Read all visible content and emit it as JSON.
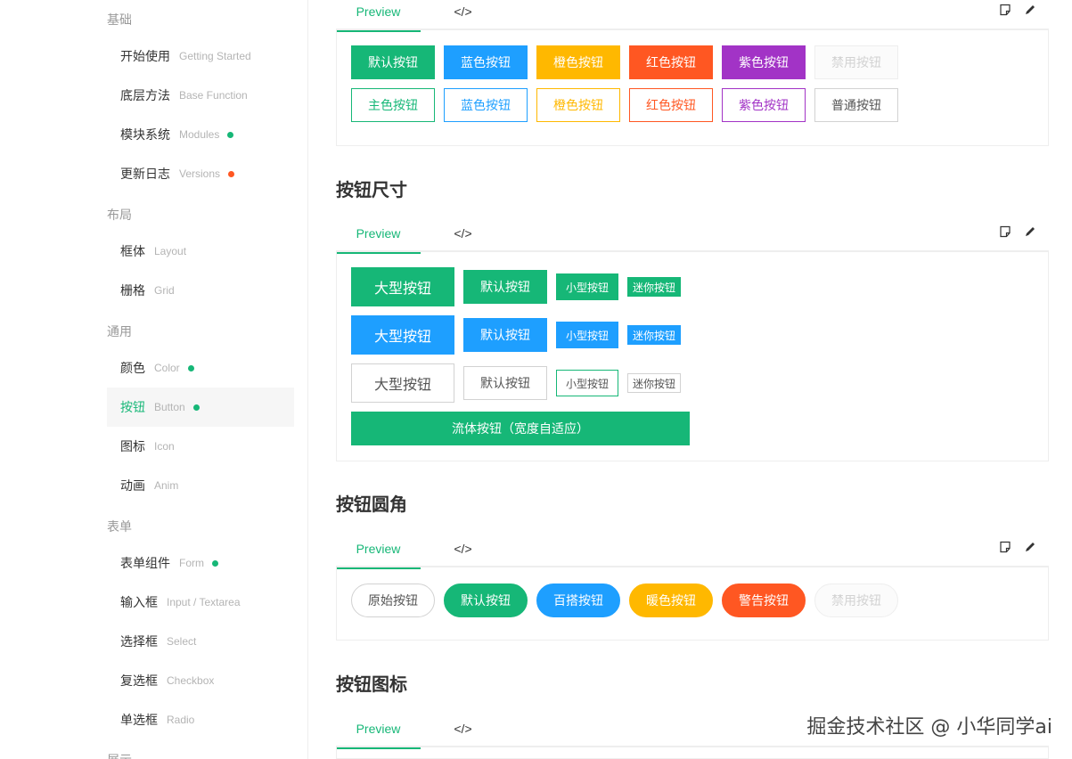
{
  "sidebar": {
    "groups": {
      "basic": "基础",
      "layout": "布局",
      "common": "通用",
      "form": "表单",
      "display": "展示"
    },
    "items": [
      {
        "cn": "开始使用",
        "en": "Getting Started"
      },
      {
        "cn": "底层方法",
        "en": "Base Function"
      },
      {
        "cn": "模块系统",
        "en": "Modules",
        "dot": "#16b777"
      },
      {
        "cn": "更新日志",
        "en": "Versions",
        "dot": "#ff5722"
      },
      {
        "cn": "框体",
        "en": "Layout"
      },
      {
        "cn": "栅格",
        "en": "Grid"
      },
      {
        "cn": "颜色",
        "en": "Color",
        "dot": "#16b777"
      },
      {
        "cn": "按钮",
        "en": "Button",
        "dot": "#16b777",
        "active": true
      },
      {
        "cn": "图标",
        "en": "Icon"
      },
      {
        "cn": "动画",
        "en": "Anim"
      },
      {
        "cn": "表单组件",
        "en": "Form",
        "dot": "#16b777"
      },
      {
        "cn": "输入框",
        "en": "Input / Textarea"
      },
      {
        "cn": "选择框",
        "en": "Select"
      },
      {
        "cn": "复选框",
        "en": "Checkbox"
      },
      {
        "cn": "单选框",
        "en": "Radio"
      }
    ]
  },
  "tabs": {
    "preview": "Preview",
    "code": "</>"
  },
  "icons": {
    "copy": "note-icon",
    "edit": "pencil-icon"
  },
  "colors": {
    "green": "#16b777",
    "blue": "#1e9fff",
    "orange": "#ffb800",
    "red": "#ff5722",
    "purple": "#a233c6"
  },
  "section_color": {
    "row1": [
      "默认按钮",
      "蓝色按钮",
      "橙色按钮",
      "红色按钮",
      "紫色按钮",
      "禁用按钮"
    ],
    "row2": [
      "主色按钮",
      "蓝色按钮",
      "橙色按钮",
      "红色按钮",
      "紫色按钮",
      "普通按钮"
    ]
  },
  "section_size": {
    "title": "按钮尺寸",
    "sizes": [
      "大型按钮",
      "默认按钮",
      "小型按钮",
      "迷你按钮"
    ],
    "fluid": "流体按钮（宽度自适应）"
  },
  "section_radius": {
    "title": "按钮圆角",
    "buttons": [
      "原始按钮",
      "默认按钮",
      "百搭按钮",
      "暖色按钮",
      "警告按钮",
      "禁用按钮"
    ]
  },
  "section_icon": {
    "title": "按钮图标"
  },
  "watermark": "掘金技术社区 @ 小华同学ai"
}
